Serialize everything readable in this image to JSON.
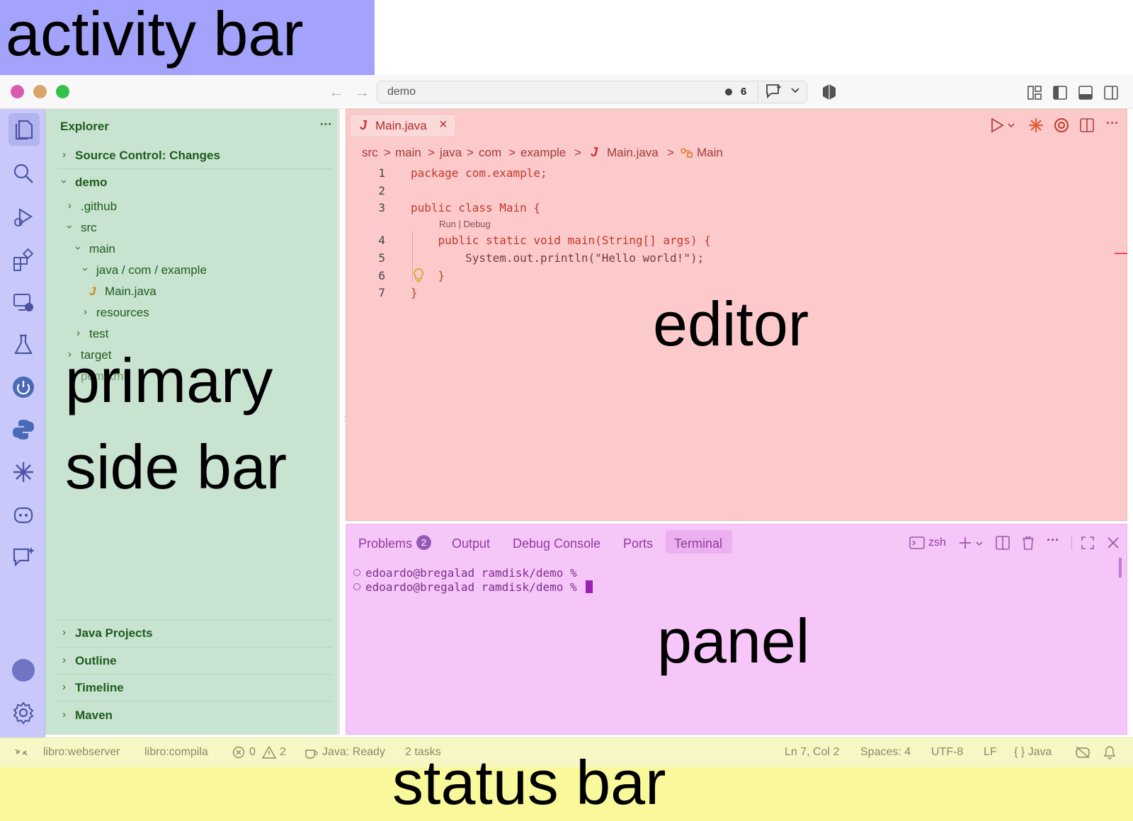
{
  "labels": {
    "activity_bar": "activity bar",
    "primary_side_bar_line1": "primary",
    "primary_side_bar_line2": "side bar",
    "editor": "editor",
    "panel": "panel",
    "status_bar": "status bar"
  },
  "titlebar": {
    "command_center_text": "demo",
    "problems_count": "6"
  },
  "sidebar": {
    "title": "Explorer",
    "more": "···",
    "sections": [
      {
        "label": "Source Control: Changes"
      },
      {
        "label": "demo"
      }
    ],
    "tree": [
      {
        "label": ".github"
      },
      {
        "label": "src"
      },
      {
        "label": "main"
      },
      {
        "label": "java / com / example"
      },
      {
        "label": "Main.java"
      },
      {
        "label": "resources"
      },
      {
        "label": "test"
      },
      {
        "label": "target"
      },
      {
        "label": "pom.xml"
      }
    ],
    "bottom_sections": [
      {
        "label": "Java Projects"
      },
      {
        "label": "Outline"
      },
      {
        "label": "Timeline"
      },
      {
        "label": "Maven"
      }
    ]
  },
  "editor": {
    "tab_label": "Main.java",
    "breadcrumb": [
      "src",
      "main",
      "java",
      "com",
      "example",
      "Main.java",
      "Main"
    ],
    "codelens": "Run | Debug",
    "lines": [
      {
        "n": "1",
        "code": "package com.example;"
      },
      {
        "n": "2",
        "code": ""
      },
      {
        "n": "3",
        "code": "public class Main {"
      },
      {
        "n": "4",
        "code": "    public static void main(String[] args) {"
      },
      {
        "n": "5",
        "code": "        System.out.println(\"Hello world!\");"
      },
      {
        "n": "6",
        "code": "    }"
      },
      {
        "n": "7",
        "code": "}"
      }
    ]
  },
  "panel": {
    "tabs": [
      "Problems",
      "Output",
      "Debug Console",
      "Ports",
      "Terminal"
    ],
    "problems_badge": "2",
    "shell": "zsh",
    "terminal_lines": [
      "edoardo@bregalad ramdisk/demo %",
      "edoardo@bregalad ramdisk/demo %"
    ]
  },
  "status_bar": {
    "items_left": [
      "libro:webserver",
      "libro:compila",
      "0",
      "2",
      "Java: Ready",
      "2 tasks"
    ],
    "items_right": [
      "Ln 7, Col 2",
      "Spaces: 4",
      "UTF-8",
      "LF",
      "{ } Java"
    ]
  },
  "colors": {
    "activity_bar": "#c8c8fa",
    "side_bar": "#c8e3cf",
    "editor": "#fccaca",
    "panel": "#f6c6f9",
    "status_bar": "#f7f7c6"
  }
}
